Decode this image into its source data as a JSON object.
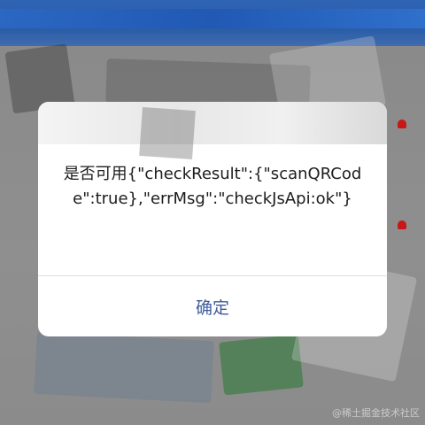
{
  "dialog": {
    "message": "是否可用{\"checkResult\":{\"scanQRCode\":true},\"errMsg\":\"checkJsApi:ok\"}",
    "confirm_label": "确定"
  },
  "watermark": "@稀土掘金技术社区",
  "colors": {
    "background_top": "#2f63b4",
    "background": "#8e8e8e",
    "dialog_bg": "#ffffff",
    "confirm_text": "#3d5b9a",
    "alert_icon": "#c81717"
  },
  "icons": [
    "bell-icon",
    "bell-icon"
  ]
}
